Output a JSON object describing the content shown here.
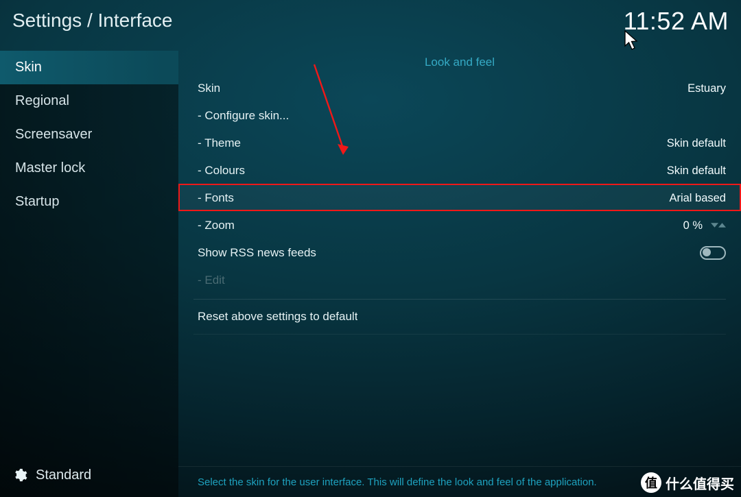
{
  "header": {
    "breadcrumb": "Settings / Interface",
    "clock": "11:52 AM"
  },
  "sidebar": {
    "items": [
      {
        "label": "Skin",
        "selected": true
      },
      {
        "label": "Regional",
        "selected": false
      },
      {
        "label": "Screensaver",
        "selected": false
      },
      {
        "label": "Master lock",
        "selected": false
      },
      {
        "label": "Startup",
        "selected": false
      }
    ],
    "level_label": "Standard"
  },
  "section": {
    "title": "Look and feel",
    "rows": [
      {
        "label": "Skin",
        "value": "Estuary",
        "type": "select"
      },
      {
        "label": "- Configure skin...",
        "value": "",
        "type": "action"
      },
      {
        "label": "- Theme",
        "value": "Skin default",
        "type": "select"
      },
      {
        "label": "- Colours",
        "value": "Skin default",
        "type": "select"
      },
      {
        "label": "- Fonts",
        "value": "Arial based",
        "type": "select",
        "highlighted": true
      },
      {
        "label": "- Zoom",
        "value": "0 %",
        "type": "spinner"
      },
      {
        "label": "Show RSS news feeds",
        "value": "",
        "type": "toggle",
        "toggle_on": false
      },
      {
        "label": "- Edit",
        "value": "",
        "type": "action",
        "disabled": true
      }
    ],
    "reset_label": "Reset above settings to default"
  },
  "footer": {
    "help": "Select the skin for the user interface. This will define the look and feel of the application."
  },
  "watermark": {
    "badge": "值",
    "text": "什么值得买"
  }
}
